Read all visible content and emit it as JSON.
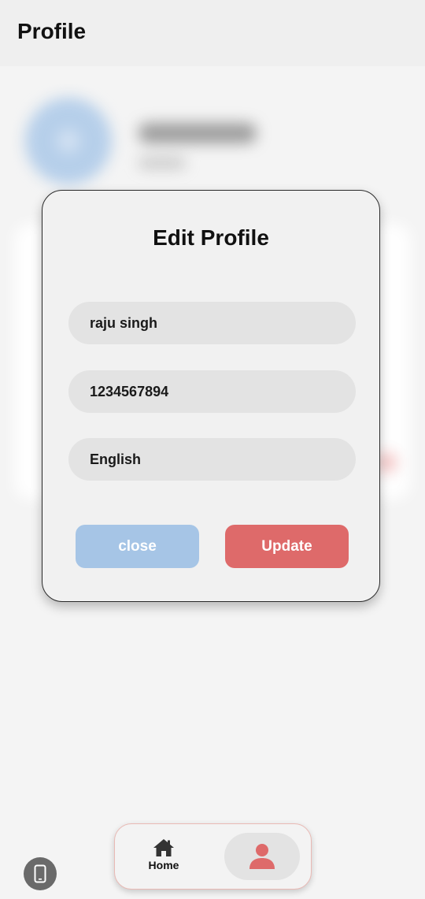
{
  "app_bar": {
    "title": "Profile"
  },
  "dialog": {
    "title": "Edit Profile",
    "fields": [
      {
        "value": "raju singh"
      },
      {
        "value": "1234567894"
      },
      {
        "value": "English"
      }
    ],
    "close_label": "close",
    "update_label": "Update"
  },
  "bottom_nav": {
    "home_label": "Home",
    "home_icon": "home-icon",
    "profile_icon": "person-icon",
    "active_tab": "profile"
  },
  "colors": {
    "accent_red": "#de6a6a",
    "close_blue": "#a6c5e6",
    "field_bg": "#e3e3e3"
  }
}
